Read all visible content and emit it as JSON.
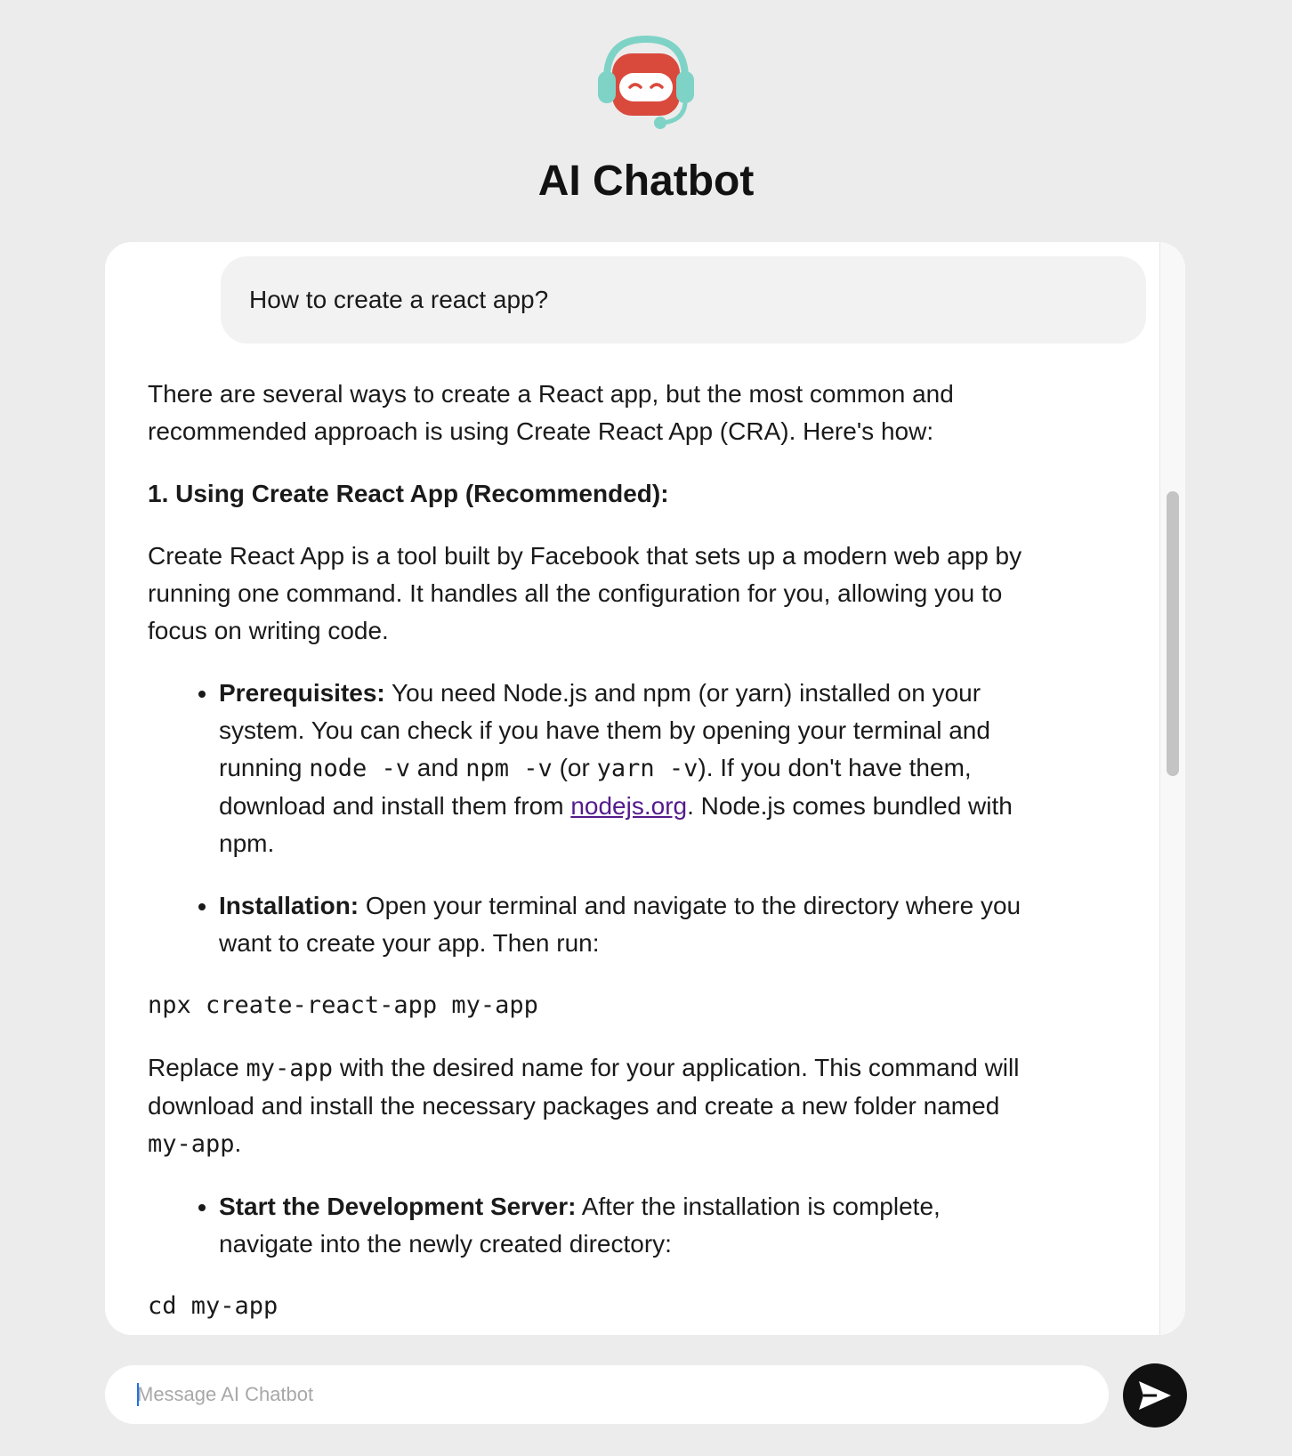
{
  "app": {
    "title": "AI Chatbot"
  },
  "colors": {
    "logo_headset": "#7ed3c6",
    "logo_face": "#d94a3d",
    "send_button": "#111111",
    "link": "#551a8b"
  },
  "messages": {
    "user": "How to create a react app?",
    "answer": {
      "intro": "There are several ways to create a React app, but the most common and recommended approach is using Create React App (CRA). Here's how:",
      "heading": "1. Using Create React App (Recommended):",
      "para1": "Create React App is a tool built by Facebook that sets up a modern web app by running one command. It handles all the configuration for you, allowing you to focus on writing code.",
      "prereq": {
        "label": "Prerequisites:",
        "t1": " You need Node.js and npm (or yarn) installed on your system. You can check if you have them by opening your terminal and running ",
        "c1": "node -v",
        "t2": " and ",
        "c2": "npm -v",
        "t3": " (or ",
        "c3": "yarn -v",
        "t4": "). If you don't have them, download and install them from ",
        "link": "nodejs.org",
        "t5": ". Node.js comes bundled with npm."
      },
      "install": {
        "label": "Installation:",
        "text": " Open your terminal and navigate to the directory where you want to create your app. Then run:"
      },
      "code1": "npx create-react-app my-app",
      "replace": {
        "t1": "Replace ",
        "c1": "my-app",
        "t2": " with the desired name for your application. This command will download and install the necessary packages and create a new folder named ",
        "c2": "my-app",
        "t3": "."
      },
      "server": {
        "label": "Start the Development Server:",
        "text": " After the installation is complete, navigate into the newly created directory:"
      },
      "code2": "cd my-app"
    }
  },
  "composer": {
    "placeholder": "Message AI Chatbot",
    "send_icon": "send-icon"
  }
}
